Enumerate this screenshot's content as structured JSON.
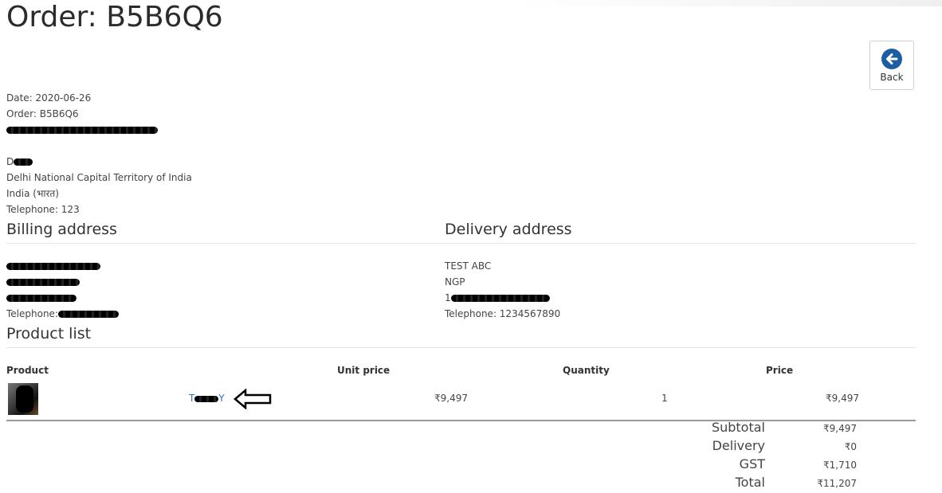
{
  "page": {
    "title": "Order: B5B6Q6",
    "back_label": "Back"
  },
  "order_info": {
    "date": "Date: 2020-06-26",
    "order": "Order: B5B6Q6",
    "name_initial": "D",
    "region": "Delhi National Capital Territory of India",
    "country": "India (भारत)",
    "telephone": "Telephone: 123"
  },
  "billing": {
    "heading": "Billing address",
    "telephone_label": "Telephone:"
  },
  "delivery": {
    "heading": "Delivery address",
    "line1": "TEST ABC",
    "line2": "NGP",
    "line3_prefix": "1",
    "telephone": "Telephone: 1234567890"
  },
  "products": {
    "heading": "Product list",
    "columns": [
      "Product",
      "Unit price",
      "Quantity",
      "Price"
    ],
    "rows": [
      {
        "name_start": "T",
        "name_end": "Y",
        "unit_price": "₹9,497",
        "quantity": "1",
        "price": "₹9,497"
      }
    ]
  },
  "totals": [
    {
      "label": "Subtotal",
      "value": "₹9,497"
    },
    {
      "label": "Delivery",
      "value": "₹0"
    },
    {
      "label": "GST",
      "value": "₹1,710"
    },
    {
      "label": "Total",
      "value": "₹11,207"
    }
  ],
  "icons": {
    "back": "arrow-left-circle-icon",
    "annotation": "left-arrow-outline-icon"
  },
  "colors": {
    "back_icon": "#1c5ea1",
    "link": "#2a76c9"
  }
}
